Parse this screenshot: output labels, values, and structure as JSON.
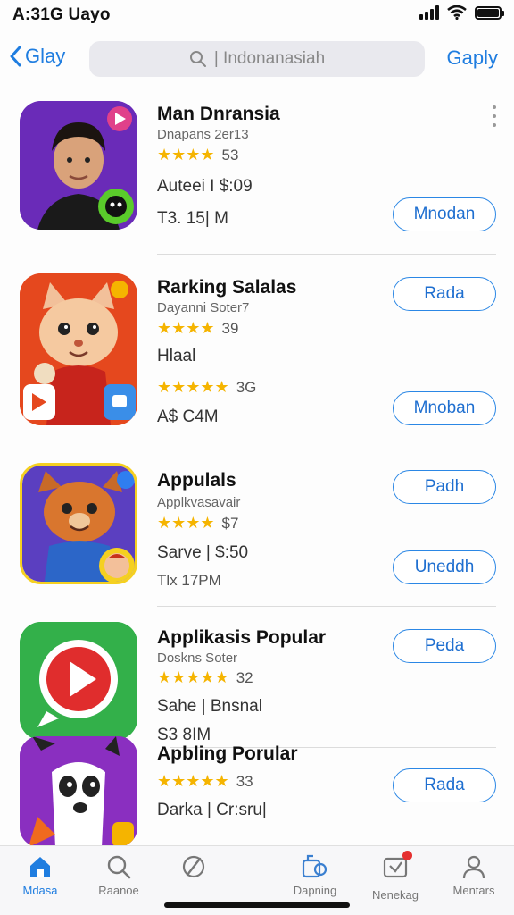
{
  "status": {
    "time": "A:31G Uayo"
  },
  "nav": {
    "back_label": "Glay",
    "search_placeholder": "| Indonanasiah",
    "right_label": "Gaply"
  },
  "apps": [
    {
      "name": "Man Dnransia",
      "subtitle": "Dnapans 2er13",
      "stars": "★★★★",
      "rating": "53",
      "line1": "Auteei I $:09",
      "line2": "T3. 15| M",
      "button": "Mnodan"
    },
    {
      "name": "Rarking Salalas",
      "subtitle": "Dayanni Soter7",
      "stars": "★★★★",
      "rating": "39",
      "line1": "Hlaal",
      "stars2": "★★★★★",
      "rating2": "3G",
      "line2": "A$ C4M",
      "button_top": "Rada",
      "button": "Mnoban"
    },
    {
      "name": "Appulals",
      "subtitle": "Applkvasavair",
      "stars": "★★★★",
      "rating": "$7",
      "line1": "Sarve | $:50",
      "line2": "Tlx 17PM",
      "button_top": "Padh",
      "button": "Uneddh"
    },
    {
      "name": "Applikasis Popular",
      "subtitle": "Doskns Soter",
      "stars": "★★★★★",
      "rating": "32",
      "line1": "Sahe | Bnsnal",
      "line2": "S3 8IM",
      "button_top": "Peda"
    },
    {
      "name": "Apbling Porular",
      "stars": "★★★★★",
      "rating": "33",
      "line1": "Darka | Cr:sru|",
      "button_top": "Rada"
    }
  ],
  "tabs": [
    {
      "label": "Mdasa",
      "icon": "home-icon"
    },
    {
      "label": "Raanoe",
      "icon": "search-icon"
    },
    {
      "label": "",
      "icon": "apps-icon"
    },
    {
      "label": "Dapning",
      "icon": "updates-icon"
    },
    {
      "label": "Nenekag",
      "icon": "inbox-icon"
    },
    {
      "label": "Mentars",
      "icon": "profile-icon"
    }
  ],
  "colors": {
    "accent": "#1f7de0",
    "star": "#f5b400",
    "badge": "#e53030"
  }
}
